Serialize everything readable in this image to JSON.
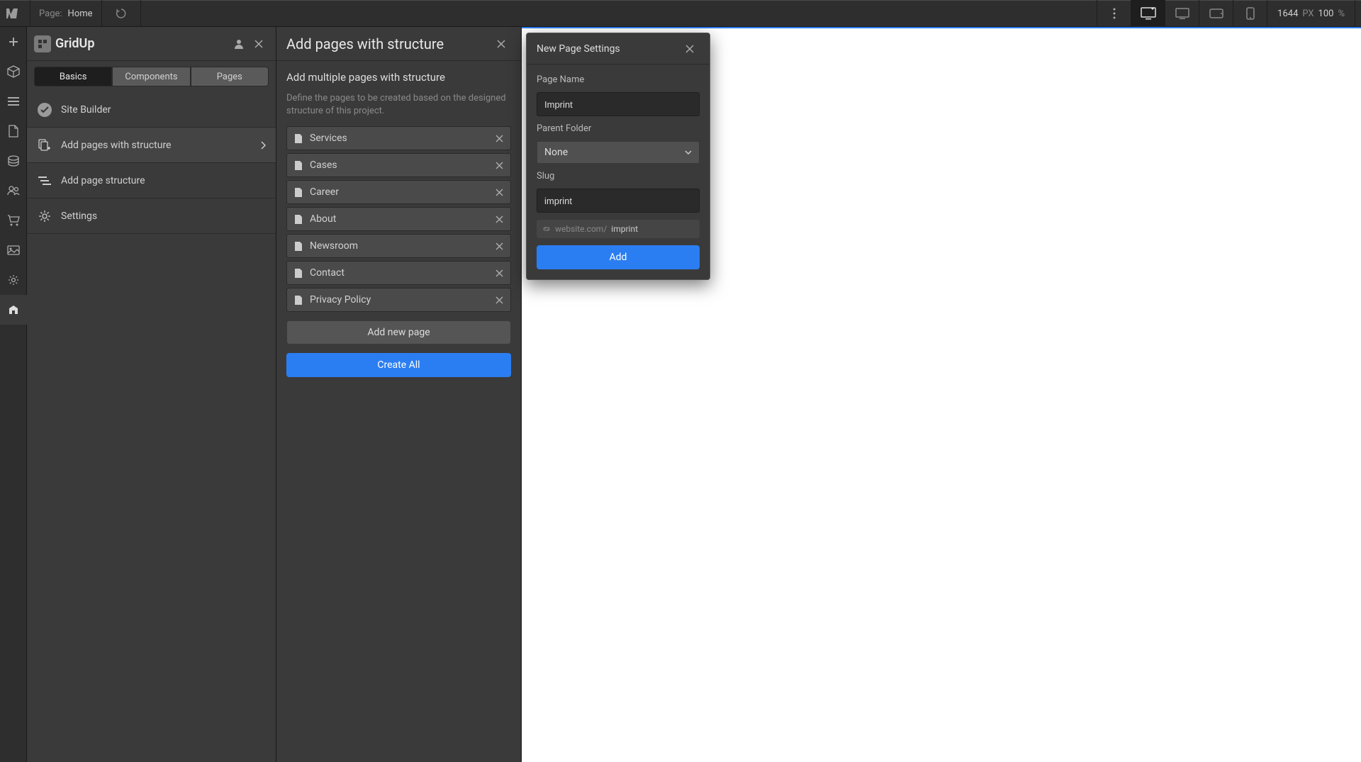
{
  "topbar": {
    "page_label": "Page:",
    "page_name": "Home",
    "viewport_px": "1644",
    "viewport_px_label": "PX",
    "zoom": "100",
    "zoom_label": "%"
  },
  "gridup": {
    "brand": "GridUp",
    "tabs": [
      {
        "label": "Basics",
        "active": true
      },
      {
        "label": "Components",
        "active": false
      },
      {
        "label": "Pages",
        "active": false
      }
    ],
    "menu": [
      {
        "label": "Site Builder",
        "icon": "check-circle-icon",
        "active": false
      },
      {
        "label": "Add pages with structure",
        "icon": "pages-add-icon",
        "active": true,
        "chevron": true
      },
      {
        "label": "Add page structure",
        "icon": "structure-icon",
        "active": false
      },
      {
        "label": "Settings",
        "icon": "gear-icon",
        "active": false
      }
    ]
  },
  "addPages": {
    "title": "Add pages with structure",
    "subhead": "Add multiple pages with structure",
    "desc": "Define the pages to be created based on the designed structure of this project.",
    "pages": [
      "Services",
      "Cases",
      "Career",
      "About",
      "Newsroom",
      "Contact",
      "Privacy Policy"
    ],
    "add_new_label": "Add new page",
    "create_all_label": "Create All"
  },
  "modal": {
    "title": "New Page Settings",
    "page_name_label": "Page Name",
    "page_name_value": "Imprint",
    "parent_folder_label": "Parent Folder",
    "parent_folder_value": "None",
    "slug_label": "Slug",
    "slug_value": "imprint",
    "url_prefix": "website.com/",
    "url_slug": "imprint",
    "add_label": "Add"
  }
}
